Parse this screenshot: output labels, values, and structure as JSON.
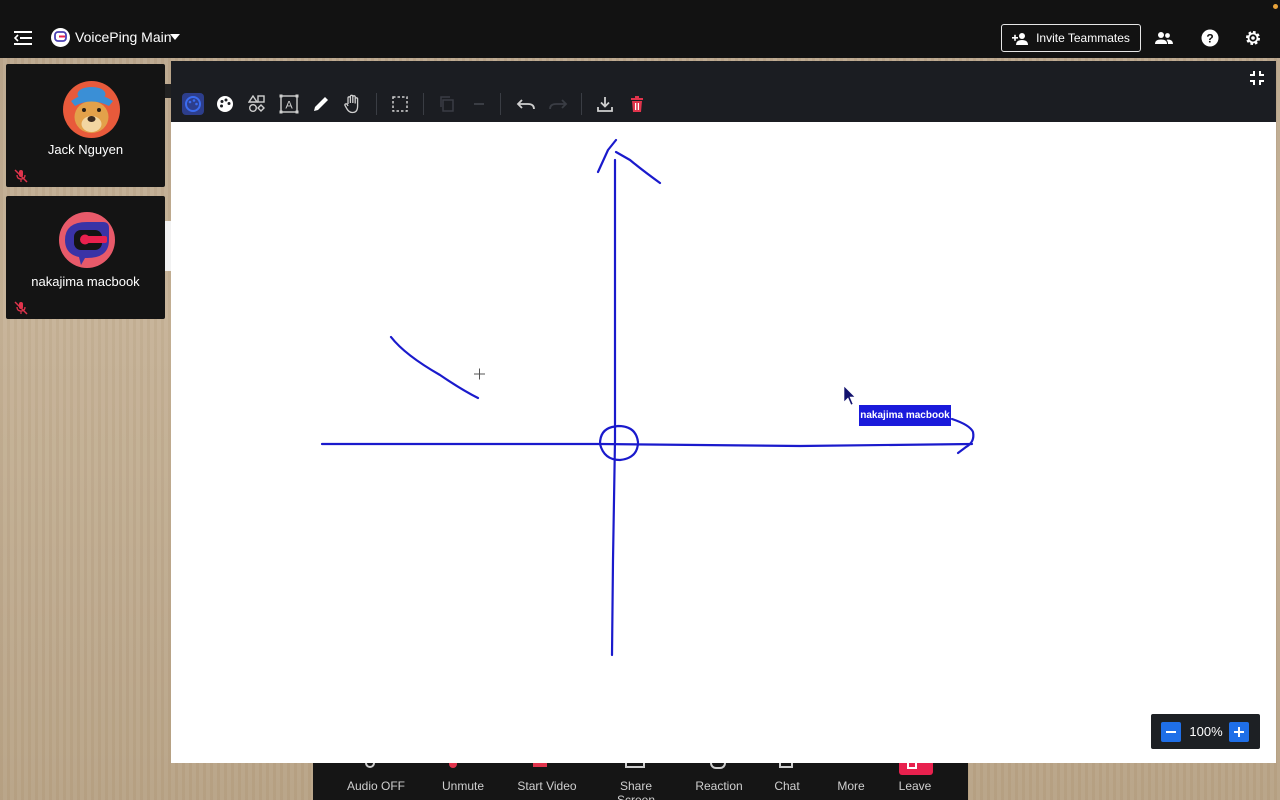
{
  "header": {
    "room_name": "VoicePing Main",
    "invite_label": "Invite Teammates"
  },
  "participants": [
    {
      "name": "Jack Nguyen",
      "muted": true,
      "avatar": "dog-avatar"
    },
    {
      "name": "nakajima macbook",
      "muted": true,
      "avatar": "voiceping-logo"
    }
  ],
  "whiteboard": {
    "tools": [
      "select-tool",
      "palette-tool",
      "shapes-tool",
      "text-tool",
      "pen-tool",
      "hand-tool",
      "marquee-select-tool",
      "copy-tool",
      "minus-tool",
      "undo-tool",
      "redo-tool",
      "download-tool",
      "delete-tool"
    ],
    "remote_cursor_label": "nakajima macbook",
    "stroke_color": "#1a1acc",
    "zoom": "100%"
  },
  "controls": [
    {
      "label": "Audio OFF"
    },
    {
      "label": "Unmute"
    },
    {
      "label": "Start Video"
    },
    {
      "label": "Share Screen"
    },
    {
      "label": "Reaction"
    },
    {
      "label": "Chat"
    },
    {
      "label": "More"
    },
    {
      "label": "Leave"
    }
  ],
  "colors": {
    "accent": "#1f6fe8",
    "leave": "#e8214e",
    "muted_mic": "#e0344c"
  }
}
